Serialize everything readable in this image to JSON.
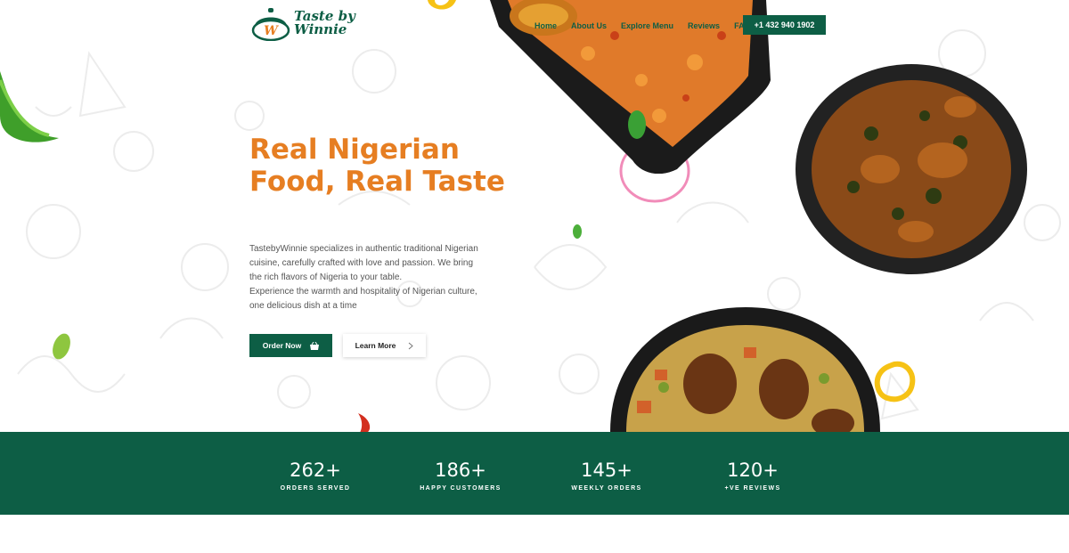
{
  "brand": {
    "logo_text_line1": "Taste by",
    "logo_text_line2": "Winnie",
    "logo_letter": "W"
  },
  "nav": {
    "items": [
      "Home",
      "About Us",
      "Explore Menu",
      "Reviews",
      "FAQ"
    ]
  },
  "header": {
    "phone": "+1 432 940 1902"
  },
  "hero": {
    "title": "Real Nigerian Food, Real Taste",
    "desc_line1": "TastebyWinnie specializes in authentic traditional Nigerian cuisine, carefully crafted with love and passion. We bring the rich flavors of Nigeria to your table.",
    "desc_line2": "Experience the warmth and hospitality of Nigerian culture, one delicious dish at a time",
    "order_label": "Order Now",
    "learn_label": "Learn More",
    "order_icon": "basket-icon",
    "learn_icon": "chevron-right-icon"
  },
  "stats": [
    {
      "value": "262+",
      "label": "ORDERS SERVED"
    },
    {
      "value": "186+",
      "label": "HAPPY CUSTOMERS"
    },
    {
      "value": "145+",
      "label": "WEEKLY ORDERS"
    },
    {
      "value": "120+",
      "label": "+VE REVIEWS"
    }
  ],
  "colors": {
    "brand_green": "#0d5e45",
    "accent_orange": "#e67e22"
  }
}
